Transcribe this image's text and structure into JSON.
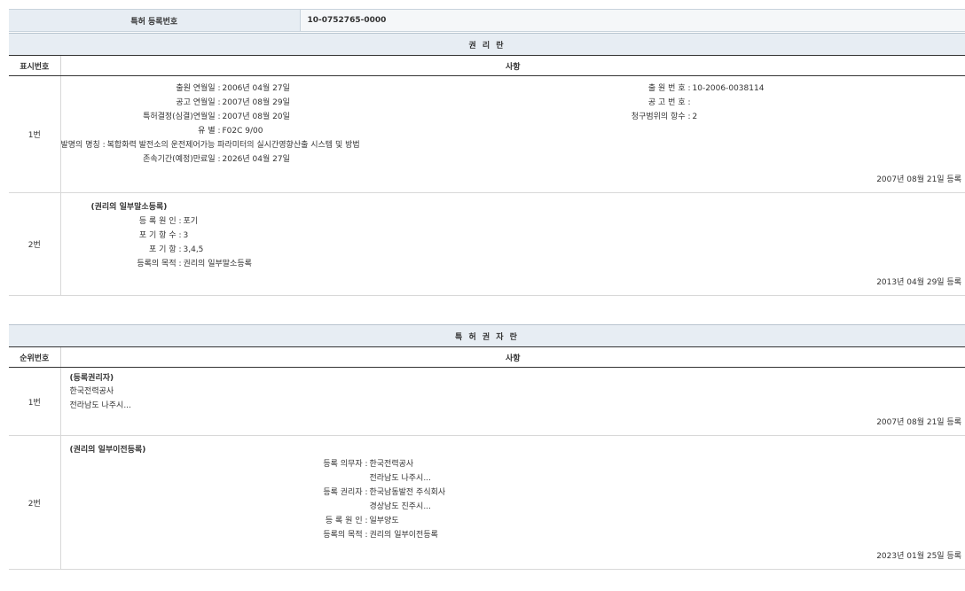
{
  "header": {
    "label": "특허 등록번호",
    "value": "10-0752765-0000"
  },
  "rights": {
    "title": "권 리 란",
    "col_index": "표시번호",
    "col_content": "사항",
    "rows": [
      {
        "num": "1번",
        "left": [
          {
            "k": "출원 연월일 :",
            "v": "2006년 04월 27일"
          },
          {
            "k": "공고 연월일 :",
            "v": "2007년 08월 29일"
          },
          {
            "k": "특허결정(심결)연월일 :",
            "v": "2007년 08월 20일"
          },
          {
            "k": "유 별 :",
            "v": "F02C 9/00"
          },
          {
            "k": "발명의 명칭 :",
            "v": "복합화력 발전소의 운전제어가능 파라미터의 실시간영향산출 시스템 및 방법"
          },
          {
            "k": "존속기간(예정)만료일 :",
            "v": "2026년 04월 27일"
          }
        ],
        "right": [
          {
            "k": "출 원 번 호 :",
            "v": "10-2006-0038114"
          },
          {
            "k": "공 고 번 호 :",
            "v": ""
          },
          {
            "k": "청구범위의 항수 :",
            "v": "2"
          }
        ],
        "date": "2007년 08월 21일 등록"
      },
      {
        "num": "2번",
        "heading": "(권리의 일부말소등록)",
        "left": [
          {
            "k": "등 록 원 인 :",
            "v": "포기"
          },
          {
            "k": "포 기 항 수 :",
            "v": "3"
          },
          {
            "k": "포 기 항 :",
            "v": "3,4,5"
          },
          {
            "k": "등록의 목적 :",
            "v": "권리의 일부말소등록"
          }
        ],
        "date": "2013년 04월 29일 등록"
      }
    ]
  },
  "owners": {
    "title": "특 허 권 자 란",
    "col_index": "순위번호",
    "col_content": "사항",
    "rows": [
      {
        "num": "1번",
        "heading": "(등록권리자)",
        "lines": [
          "한국전력공사",
          "전라남도 나주시..."
        ],
        "date": "2007년 08월 21일 등록"
      },
      {
        "num": "2번",
        "heading": "(권리의 일부이전등록)",
        "items": [
          {
            "k": "등록 의무자 :",
            "v": "한국전력공사"
          },
          {
            "k": "",
            "v": "전라남도 나주시..."
          },
          {
            "k": "등록 권리자 :",
            "v": "한국남동발전 주식회사"
          },
          {
            "k": "",
            "v": "경상남도 진주시..."
          },
          {
            "k": "등 록 원 인 :",
            "v": "일부양도"
          },
          {
            "k": "등록의 목적 :",
            "v": "권리의 일부이전등록"
          }
        ],
        "date": "2023년 01월 25일 등록"
      }
    ]
  }
}
